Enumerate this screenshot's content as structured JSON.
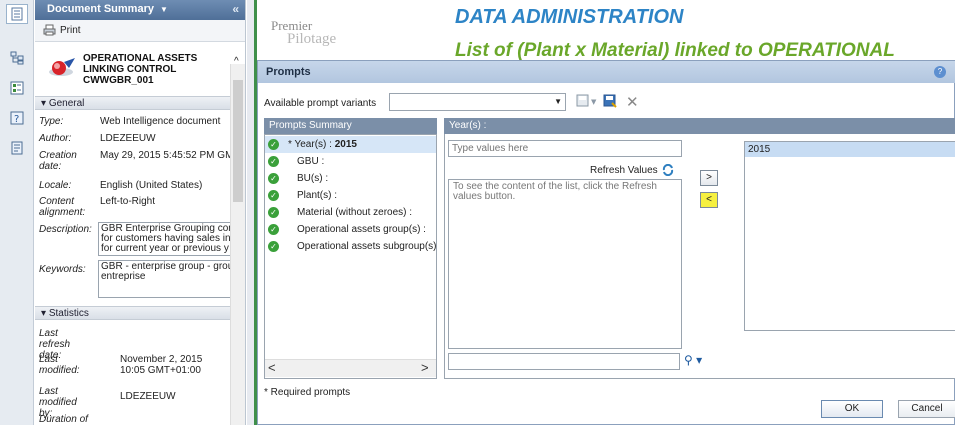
{
  "left_panel": {
    "title": "Document Summary",
    "print_label": "Print",
    "doc_title": "OPERATIONAL ASSETS LINKING CONTROL CWWGBR_001",
    "general_section": "General",
    "fields": {
      "type_label": "Type:",
      "type_value": "Web Intelligence document",
      "author_label": "Author:",
      "author_value": "LDEZEEUW",
      "creation_label": "Creation date:",
      "creation_value": "May 29, 2015 5:45:52 PM GM",
      "locale_label": "Locale:",
      "locale_value": "English (United States)",
      "alignment_label": "Content alignment:",
      "alignment_value": "Left-to-Right",
      "description_label": "Description:",
      "description_value": "GBR Enterprise Grouping con\nfor customers having sales in\nfor current year or previous y",
      "keywords_label": "Keywords:",
      "keywords_value": "GBR - enterprise group - grou\nentreprise"
    },
    "statistics_section": "Statistics",
    "stats": {
      "last_refresh_label": "Last refresh date:",
      "last_modified_label": "Last modified:",
      "last_modified_value": "November 2, 2015 10:05 GMT+01:00",
      "last_modified_by_label": "Last modified by:",
      "last_modified_by_value": "LDEZEEUW",
      "duration_label": "Duration of"
    }
  },
  "report": {
    "logo_line1": "Premier",
    "logo_line2": "Pilotage",
    "title": "DATA ADMINISTRATION",
    "subtitle": "List of (Plant x Material) linked to OPERATIONAL"
  },
  "dialog": {
    "title": "Prompts",
    "help": "?",
    "variants_label": "Available prompt variants",
    "summary_header": "Prompts Summary",
    "prompts": [
      {
        "prefix": "* Year(s) : ",
        "value": "2015"
      },
      {
        "prefix": "GBU :",
        "value": ""
      },
      {
        "prefix": "BU(s) :",
        "value": ""
      },
      {
        "prefix": "Plant(s) :",
        "value": ""
      },
      {
        "prefix": "Material (without zeroes) :",
        "value": ""
      },
      {
        "prefix": "Operational assets group(s) :",
        "value": ""
      },
      {
        "prefix": "Operational assets subgroup(s) :",
        "value": ""
      }
    ],
    "year_header": "Year(s) :",
    "type_placeholder": "Type values here",
    "refresh_label": "Refresh Values",
    "list_hint": "To see the content of the list, click the Refresh values button.",
    "add_label": ">",
    "remove_label": "<",
    "selected_values": [
      "2015"
    ],
    "required_note": "* Required prompts",
    "ok_label": "OK",
    "cancel_label": "Cancel"
  }
}
